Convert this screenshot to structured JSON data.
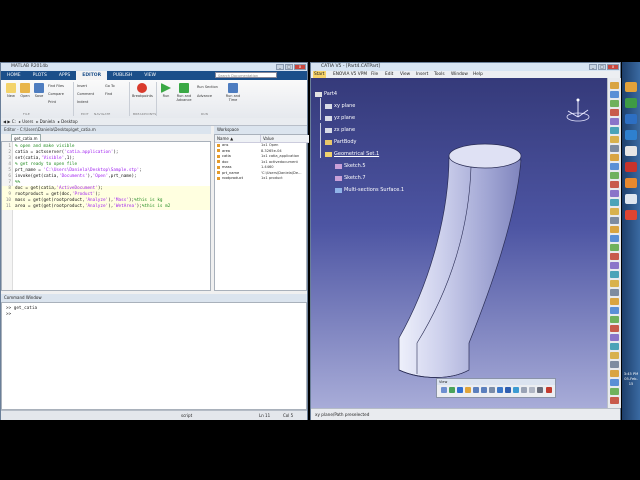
{
  "matlab": {
    "title": "MATLAB R2014b",
    "tabs": [
      "HOME",
      "PLOTS",
      "APPS",
      "EDITOR",
      "PUBLISH",
      "VIEW"
    ],
    "active_tab": "EDITOR",
    "search_placeholder": "Search Documentation",
    "ribbon": {
      "new": "New",
      "open": "Open",
      "save": "Save",
      "find_files": "Find Files",
      "compare": "Compare",
      "print": "Print",
      "insert": "Insert",
      "comment": "Comment",
      "indent": "Indent",
      "go_to": "Go To",
      "find": "Find",
      "breakpoints": "Breakpoints",
      "run": "Run",
      "run_and_advance": "Run and Advance",
      "run_section": "Run Section",
      "advance": "Advance",
      "run_and_time": "Run and Time",
      "sections": [
        "FILE",
        "NAVIGATE",
        "EDIT",
        "BREAKPOINTS",
        "RUN"
      ]
    },
    "path": [
      "C:",
      "Users",
      "Daniela",
      "Desktop"
    ],
    "editor_title": "Editor - C:\\Users\\Daniela\\Desktop\\get_catia.m",
    "editor_tab": "get_catia.m",
    "code": [
      {
        "n": "1",
        "parts": [
          {
            "t": "% open and make visible",
            "c": "com"
          }
        ]
      },
      {
        "n": "2",
        "parts": [
          {
            "t": "catia = actxserver(",
            "c": "txt"
          },
          {
            "t": "'catia.application'",
            "c": "str"
          },
          {
            "t": ");",
            "c": "txt"
          }
        ]
      },
      {
        "n": "3",
        "parts": [
          {
            "t": "set(catia,",
            "c": "txt"
          },
          {
            "t": "'Visible'",
            "c": "str"
          },
          {
            "t": ",1);",
            "c": "txt"
          }
        ]
      },
      {
        "n": "4",
        "parts": [
          {
            "t": "% get ready to open file",
            "c": "com"
          }
        ]
      },
      {
        "n": "5",
        "parts": [
          {
            "t": "prt_name = ",
            "c": "txt"
          },
          {
            "t": "'C:\\Users\\Daniela\\Desktop\\Sample.stp'",
            "c": "str"
          },
          {
            "t": ";",
            "c": "txt"
          }
        ]
      },
      {
        "n": "6",
        "parts": [
          {
            "t": "invoke(get(catia,",
            "c": "txt"
          },
          {
            "t": "'Documents'",
            "c": "str"
          },
          {
            "t": "),",
            "c": "txt"
          },
          {
            "t": "'Open'",
            "c": "str"
          },
          {
            "t": ",prt_name);",
            "c": "txt"
          }
        ]
      },
      {
        "n": "7",
        "parts": [
          {
            "t": "%%",
            "c": "com"
          }
        ]
      },
      {
        "n": "8",
        "parts": [
          {
            "t": "doc = get(catia,",
            "c": "txt"
          },
          {
            "t": "'ActiveDocument'",
            "c": "str"
          },
          {
            "t": ");",
            "c": "txt"
          }
        ]
      },
      {
        "n": "9",
        "parts": [
          {
            "t": "rootproduct = get(doc,",
            "c": "txt"
          },
          {
            "t": "'Product'",
            "c": "str"
          },
          {
            "t": ");",
            "c": "txt"
          }
        ]
      },
      {
        "n": "10",
        "parts": [
          {
            "t": "mass = get(get(rootproduct,",
            "c": "txt"
          },
          {
            "t": "'Analyze'",
            "c": "str"
          },
          {
            "t": "),",
            "c": "txt"
          },
          {
            "t": "'Mass'",
            "c": "str"
          },
          {
            "t": ");",
            "c": "txt"
          },
          {
            "t": "%this is kg",
            "c": "com"
          }
        ]
      },
      {
        "n": "11",
        "parts": [
          {
            "t": "area = get(get(rootproduct,",
            "c": "txt"
          },
          {
            "t": "'Analyze'",
            "c": "str"
          },
          {
            "t": "),",
            "c": "txt"
          },
          {
            "t": "'WetArea'",
            "c": "str"
          },
          {
            "t": ");",
            "c": "txt"
          },
          {
            "t": "%this is m2",
            "c": "com"
          }
        ]
      }
    ],
    "workspace_title": "Workspace",
    "ws_headers": {
      "name": "Name ▲",
      "value": "Value"
    },
    "workspace": [
      {
        "name": "ans",
        "value": "1x1 Open"
      },
      {
        "name": "area",
        "value": "8.3265e-04"
      },
      {
        "name": "catia",
        "value": "1x1 catia_application"
      },
      {
        "name": "doc",
        "value": "1x1 activedocument"
      },
      {
        "name": "mass",
        "value": "1.4460"
      },
      {
        "name": "prt_name",
        "value": "'C:\\Users\\Daniela\\De..."
      },
      {
        "name": "rootproduct",
        "value": "1x1 product"
      }
    ],
    "command_title": "Command Window",
    "command_lines": [
      ">> get_catia",
      ">>"
    ],
    "status": {
      "mode": "script",
      "ln": "Ln 11",
      "col": "Col 5"
    }
  },
  "catia": {
    "title": "CATIA V5 - [Part4.CATPart]",
    "menu": [
      "Start",
      "ENOVIA V5 VPM",
      "File",
      "Edit",
      "View",
      "Insert",
      "Tools",
      "Window",
      "Help"
    ],
    "tree": {
      "root": "Part4",
      "planes": [
        "xy plane",
        "yz plane",
        "zx plane"
      ],
      "body": "PartBody",
      "geoset": "Geometrical Set.1",
      "sketches": [
        "Sketch.5",
        "Sketch.7"
      ],
      "surface": "Multi-sections Surface.1"
    },
    "view_toolbar_title": "View",
    "status_text": "xy plane/Path preselected"
  },
  "taskbar": {
    "time": "3:45 PM",
    "date": "05-Feb-15"
  },
  "colors": {
    "matlab_tab_bar": "#1b4f8a",
    "catia_background_top": "#353a7a",
    "catia_background_bottom": "#a8acd8",
    "surface": "#c8cbe6"
  }
}
